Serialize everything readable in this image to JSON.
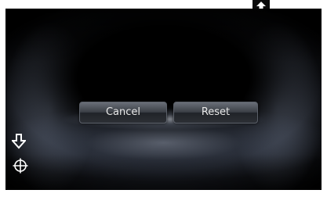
{
  "buttons": {
    "cancel_label": "Cancel",
    "reset_label": "Reset"
  },
  "icons": {
    "top": "arrow-up-icon",
    "left_arrow": "arrow-down-icon",
    "target": "crosshair-target-icon"
  },
  "colors": {
    "background": "#000000",
    "button_text": "#e8e8e8",
    "icon": "#ffffff"
  }
}
